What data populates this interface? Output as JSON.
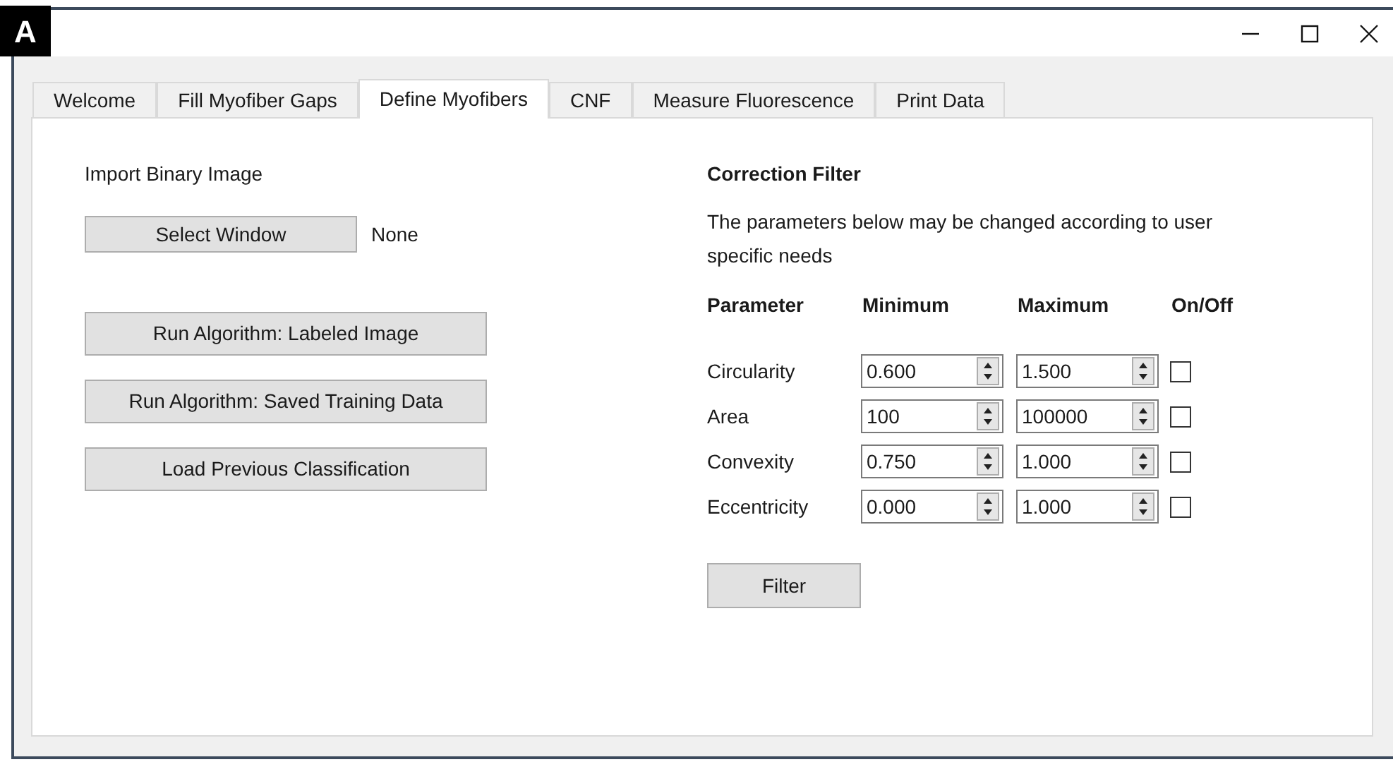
{
  "panel_label": "A",
  "tabs": [
    {
      "label": "Welcome",
      "selected": false
    },
    {
      "label": "Fill Myofiber Gaps",
      "selected": false
    },
    {
      "label": "Define Myofibers",
      "selected": true
    },
    {
      "label": "CNF",
      "selected": false
    },
    {
      "label": "Measure Fluorescence",
      "selected": false
    },
    {
      "label": "Print Data",
      "selected": false
    }
  ],
  "import": {
    "label": "Import Binary Image",
    "select_button": "Select Window",
    "selected_window": "None"
  },
  "actions": [
    "Run Algorithm: Labeled Image",
    "Run Algorithm: Saved Training Data",
    "Load Previous Classification"
  ],
  "correction_filter": {
    "title": "Correction Filter",
    "description": "The parameters below may be changed according to user specific needs",
    "columns": [
      "Parameter",
      "Minimum",
      "Maximum",
      "On/Off"
    ],
    "rows": [
      {
        "name": "Circularity",
        "minimum": "0.600",
        "maximum": "1.500",
        "on": false
      },
      {
        "name": "Area",
        "minimum": "100",
        "maximum": "100000",
        "on": false
      },
      {
        "name": "Convexity",
        "minimum": "0.750",
        "maximum": "1.000",
        "on": false
      },
      {
        "name": "Eccentricity",
        "minimum": "0.000",
        "maximum": "1.000",
        "on": false
      }
    ],
    "filter_button": "Filter"
  }
}
